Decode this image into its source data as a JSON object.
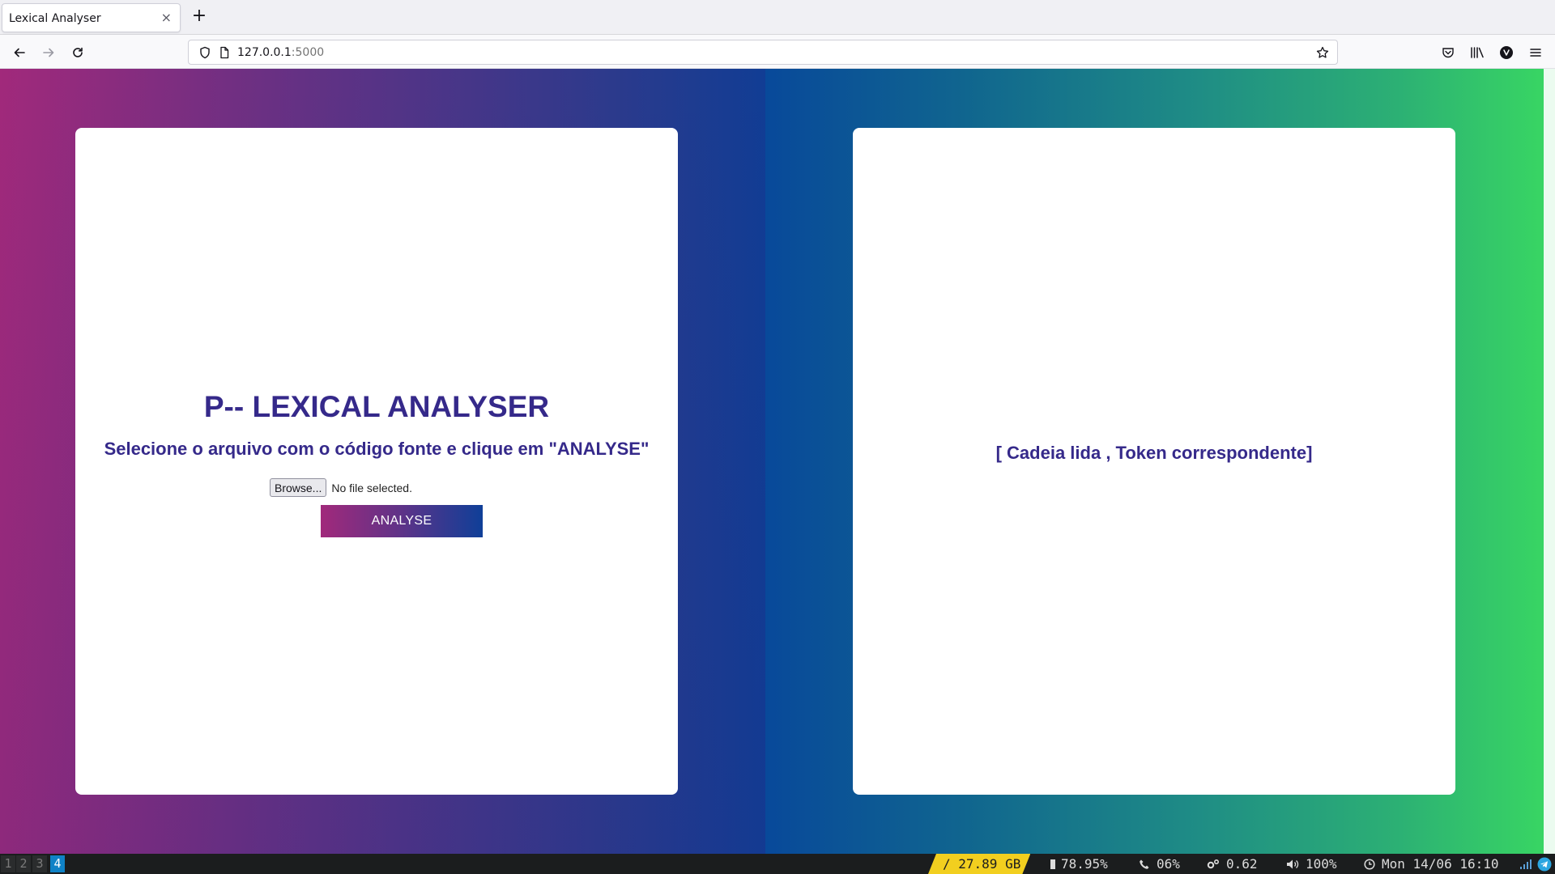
{
  "browser": {
    "tab_title": "Lexical Analyser",
    "tab_close": "×",
    "new_tab": "+",
    "url_host": "127.0.0.1",
    "url_port": ":5000"
  },
  "left_panel": {
    "title": "P-- LEXICAL ANALYSER",
    "subtitle": "Selecione o arquivo com o código fonte e clique em \"ANALYSE\"",
    "browse_label": "Browse...",
    "file_status": "No file selected.",
    "analyse_label": "ANALYSE"
  },
  "right_panel": {
    "result_placeholder": "[ Cadeia lida , Token correspondente]"
  },
  "statusbar": {
    "workspaces": [
      "1",
      "2",
      "3",
      "4"
    ],
    "active_workspace": "4",
    "disk": "/ 27.89 GB",
    "battery": "78.95%",
    "cpu": "06%",
    "load": "0.62",
    "volume": "100%",
    "datetime": "Mon 14/06 16:10"
  },
  "colors": {
    "accent_text": "#35298a",
    "gradient_left": [
      "#a1297b",
      "#113d94"
    ],
    "gradient_right": [
      "#08499a",
      "#39d862"
    ],
    "active_workspace": "#0f82c6",
    "disk_badge": "#f2cf1f"
  },
  "icons": {
    "back": "back-arrow-icon",
    "forward": "forward-arrow-icon",
    "reload": "reload-icon",
    "shield": "tracking-shield-icon",
    "page": "page-icon",
    "bookmark": "star-icon",
    "pocket": "pocket-icon",
    "library": "library-icon",
    "account": "account-icon",
    "menu": "hamburger-menu-icon"
  }
}
